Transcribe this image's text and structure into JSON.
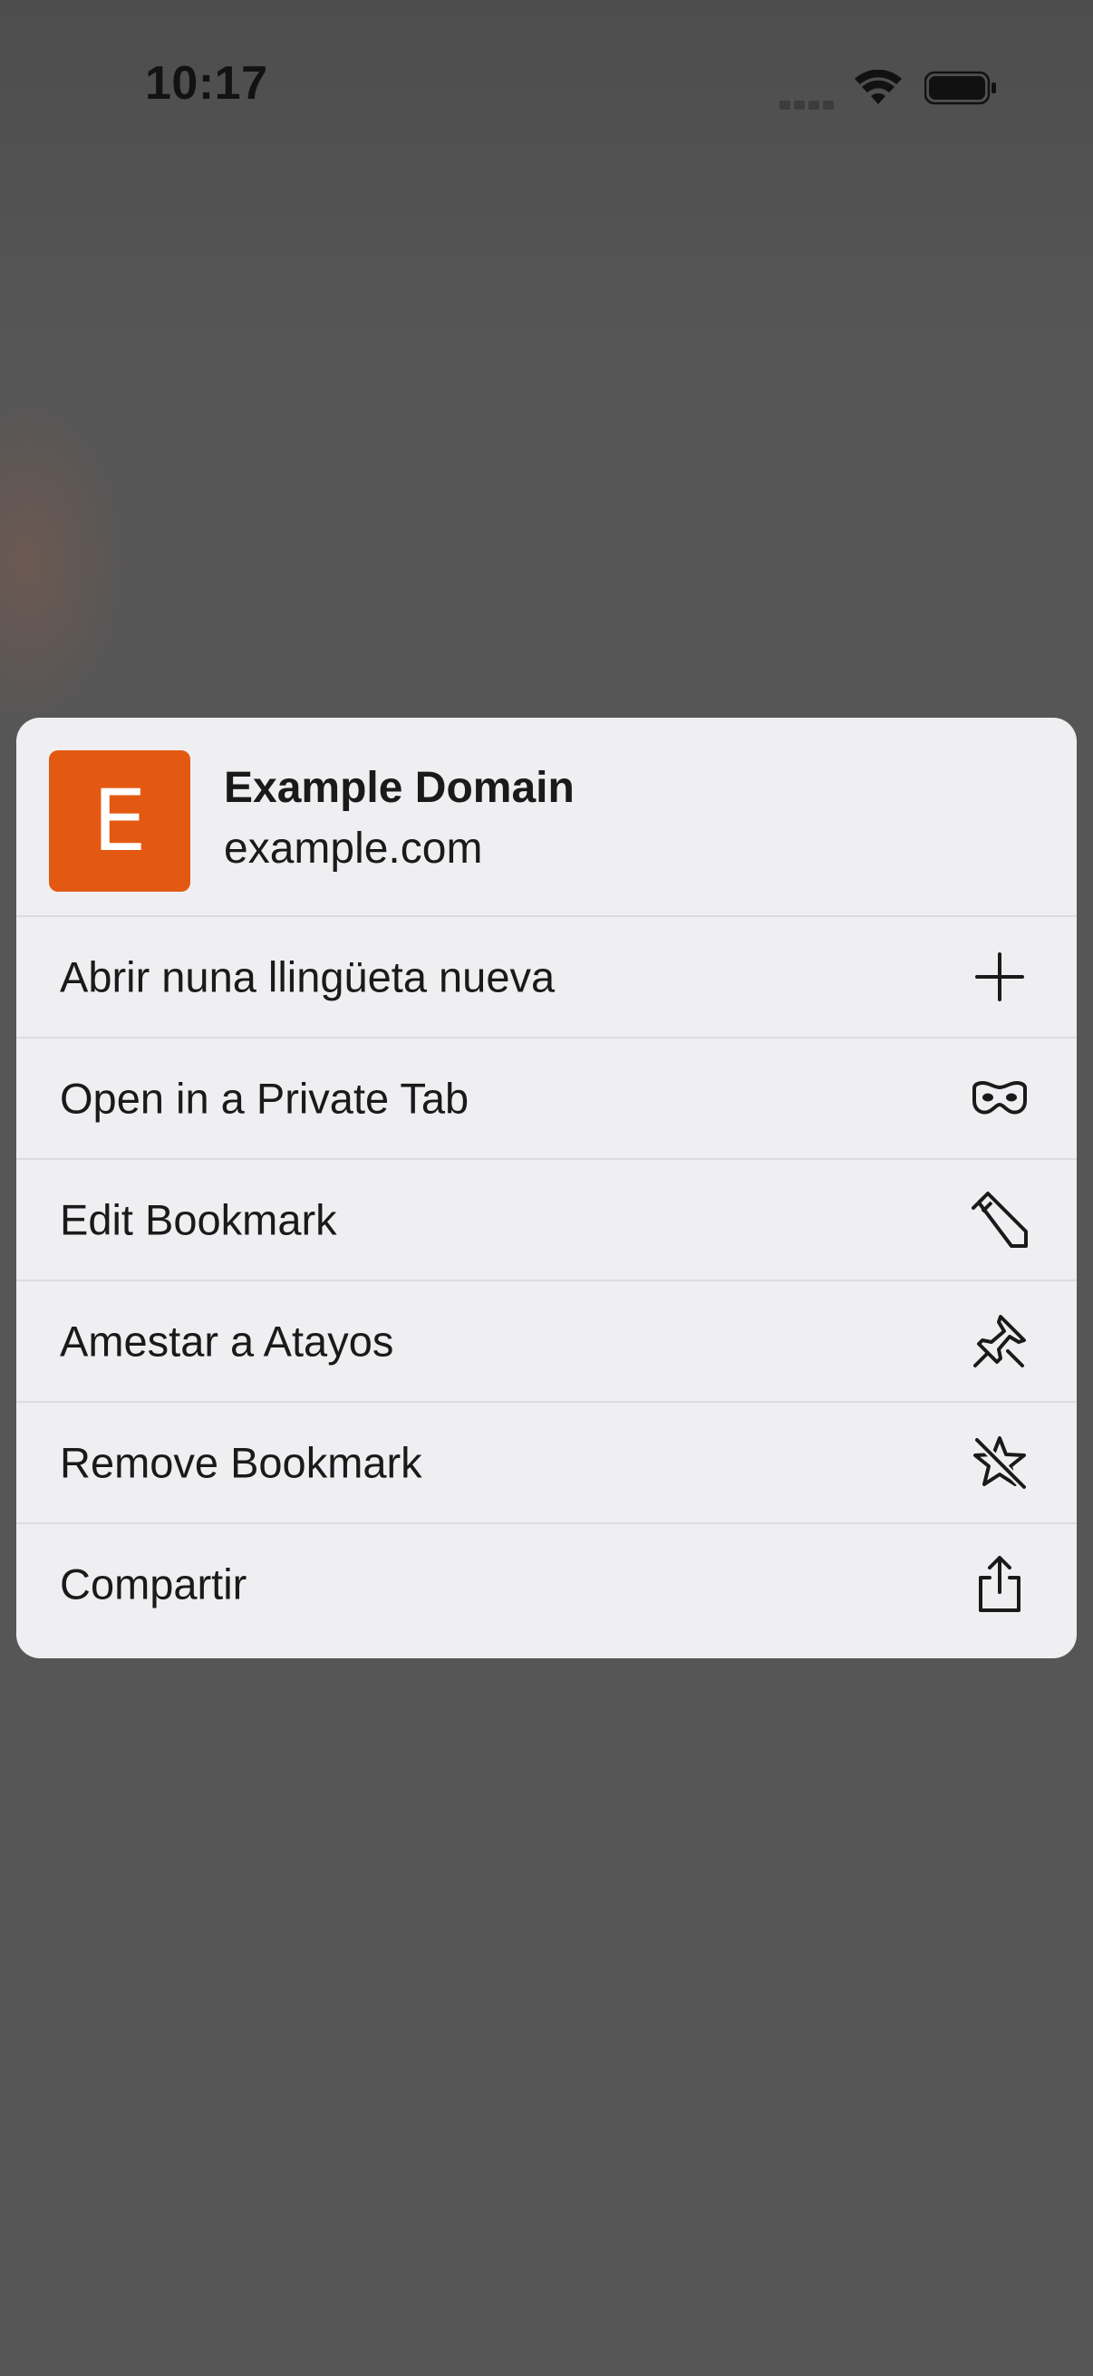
{
  "status_bar": {
    "time": "10:17"
  },
  "context_menu": {
    "header": {
      "favicon_letter": "E",
      "favicon_color": "#e35912",
      "title": "Example Domain",
      "url": "example.com"
    },
    "items": [
      {
        "label": "Abrir nuna llingüeta nueva",
        "icon": "plus-icon"
      },
      {
        "label": "Open in a Private Tab",
        "icon": "private-mask-icon"
      },
      {
        "label": "Edit Bookmark",
        "icon": "pencil-icon"
      },
      {
        "label": "Amestar a Atayos",
        "icon": "pin-icon"
      },
      {
        "label": "Remove Bookmark",
        "icon": "star-slash-icon"
      },
      {
        "label": "Compartir",
        "icon": "share-icon"
      }
    ]
  }
}
